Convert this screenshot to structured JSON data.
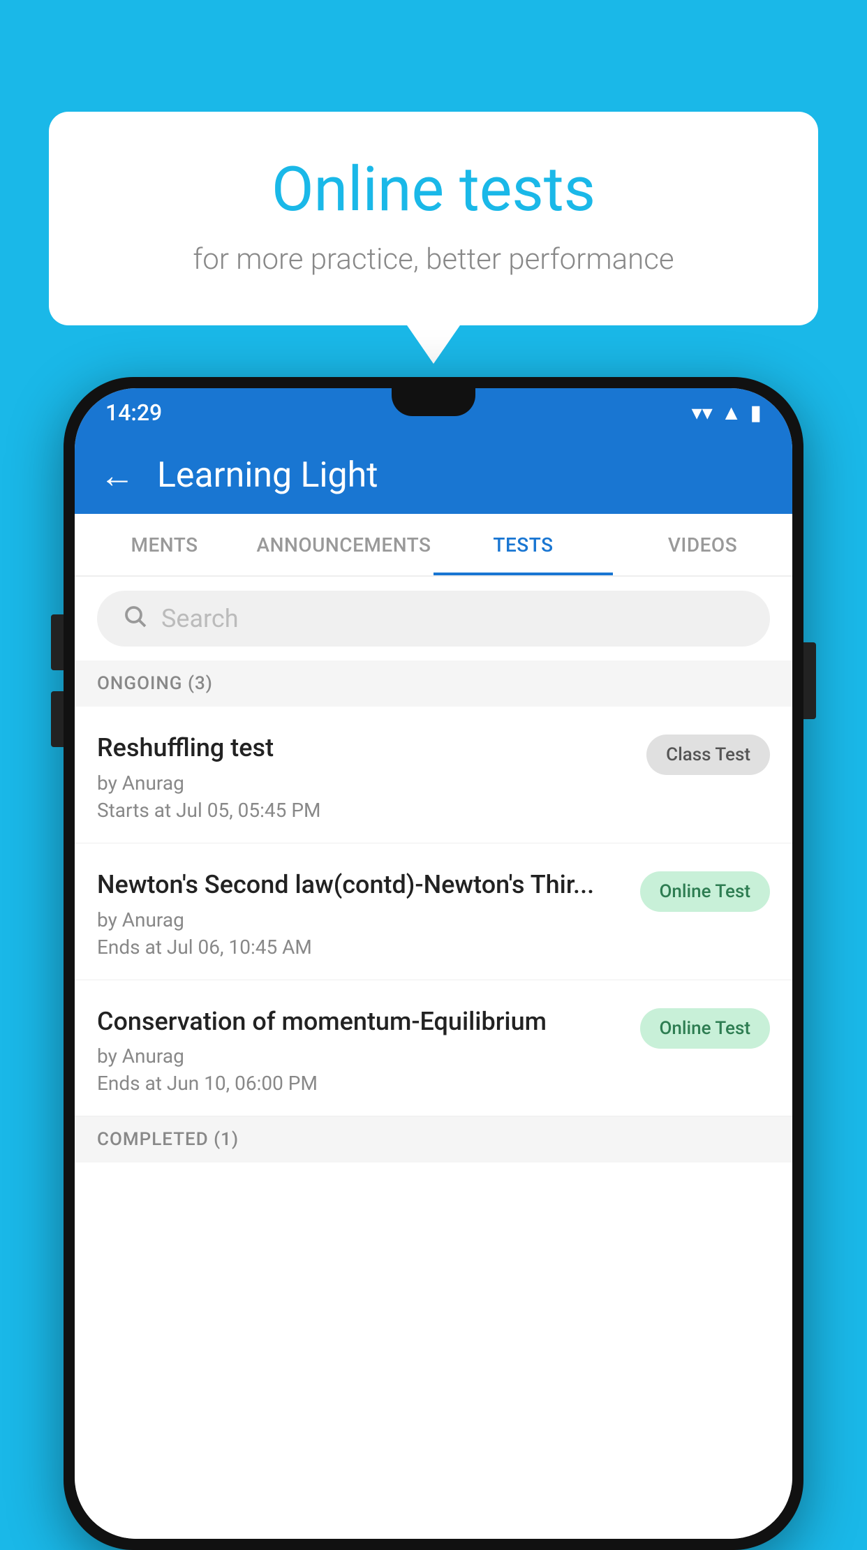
{
  "background_color": "#1ab8e8",
  "speech_bubble": {
    "title": "Online tests",
    "subtitle": "for more practice, better performance"
  },
  "phone": {
    "status_bar": {
      "time": "14:29",
      "wifi_icon": "▼",
      "signal_icon": "▲",
      "battery_icon": "▮"
    },
    "header": {
      "back_label": "←",
      "title": "Learning Light"
    },
    "tabs": [
      {
        "label": "MENTS",
        "active": false
      },
      {
        "label": "ANNOUNCEMENTS",
        "active": false
      },
      {
        "label": "TESTS",
        "active": true
      },
      {
        "label": "VIDEOS",
        "active": false
      }
    ],
    "search": {
      "placeholder": "Search"
    },
    "section_ongoing": {
      "label": "ONGOING (3)"
    },
    "tests": [
      {
        "title": "Reshuffling test",
        "author": "by Anurag",
        "date": "Starts at  Jul 05, 05:45 PM",
        "badge": "Class Test",
        "badge_type": "class"
      },
      {
        "title": "Newton's Second law(contd)-Newton's Thir...",
        "author": "by Anurag",
        "date": "Ends at  Jul 06, 10:45 AM",
        "badge": "Online Test",
        "badge_type": "online"
      },
      {
        "title": "Conservation of momentum-Equilibrium",
        "author": "by Anurag",
        "date": "Ends at  Jun 10, 06:00 PM",
        "badge": "Online Test",
        "badge_type": "online"
      }
    ],
    "section_completed": {
      "label": "COMPLETED (1)"
    }
  }
}
